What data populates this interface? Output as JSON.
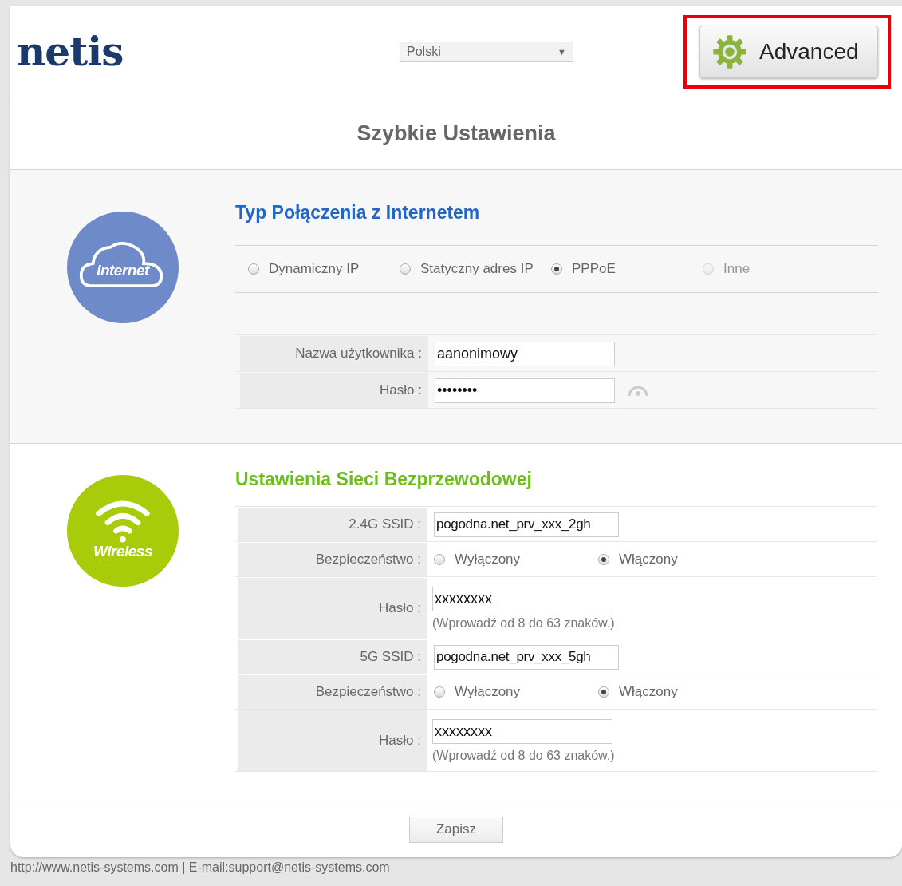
{
  "header": {
    "logo": "netis",
    "language": {
      "value": "Polski",
      "arrow": "▼"
    },
    "advanced_button": {
      "label": "Advanced",
      "highlighted": true
    }
  },
  "page_title": "Szybkie Ustawienia",
  "internet": {
    "badge": "internet",
    "title": "Typ Połączenia z Internetem",
    "connection_types": [
      {
        "label": "Dynamiczny IP",
        "selected": false,
        "disabled": false
      },
      {
        "label": "Statyczny adres IP",
        "selected": false,
        "disabled": false
      },
      {
        "label": "PPPoE",
        "selected": true,
        "disabled": false
      },
      {
        "label": "Inne",
        "selected": false,
        "disabled": true
      }
    ],
    "fields": [
      {
        "kind": "text",
        "label": "Nazwa użytkownika :",
        "value": "aanonimowy"
      },
      {
        "kind": "password",
        "label": "Hasło :",
        "value": "••••••••"
      }
    ]
  },
  "wireless": {
    "badge": "Wireless",
    "title": "Ustawienia Sieci Bezprzewodowej",
    "rows": [
      {
        "kind": "text",
        "label": "2.4G SSID :",
        "value": "pogodna.net_prv_xxx_2gh"
      },
      {
        "kind": "radio",
        "label": "Bezpieczeństwo :",
        "options": [
          {
            "label": "Wyłączony",
            "selected": false
          },
          {
            "label": "Włączony",
            "selected": true
          }
        ]
      },
      {
        "kind": "password",
        "label": "Hasło :",
        "value": "xxxxxxxx",
        "hint": "(Wprowadź od 8 do 63 znaków.)"
      },
      {
        "kind": "text",
        "label": "5G SSID :",
        "value": "pogodna.net_prv_xxx_5gh"
      },
      {
        "kind": "radio",
        "label": "Bezpieczeństwo :",
        "options": [
          {
            "label": "Wyłączony",
            "selected": false
          },
          {
            "label": "Włączony",
            "selected": true
          }
        ]
      },
      {
        "kind": "password",
        "label": "Hasło :",
        "value": "xxxxxxxx",
        "hint": "(Wprowadź od 8 do 63 znaków.)"
      }
    ]
  },
  "save_button": "Zapisz",
  "footer": "http://www.netis-systems.com | E-mail:support@netis-systems.com"
}
